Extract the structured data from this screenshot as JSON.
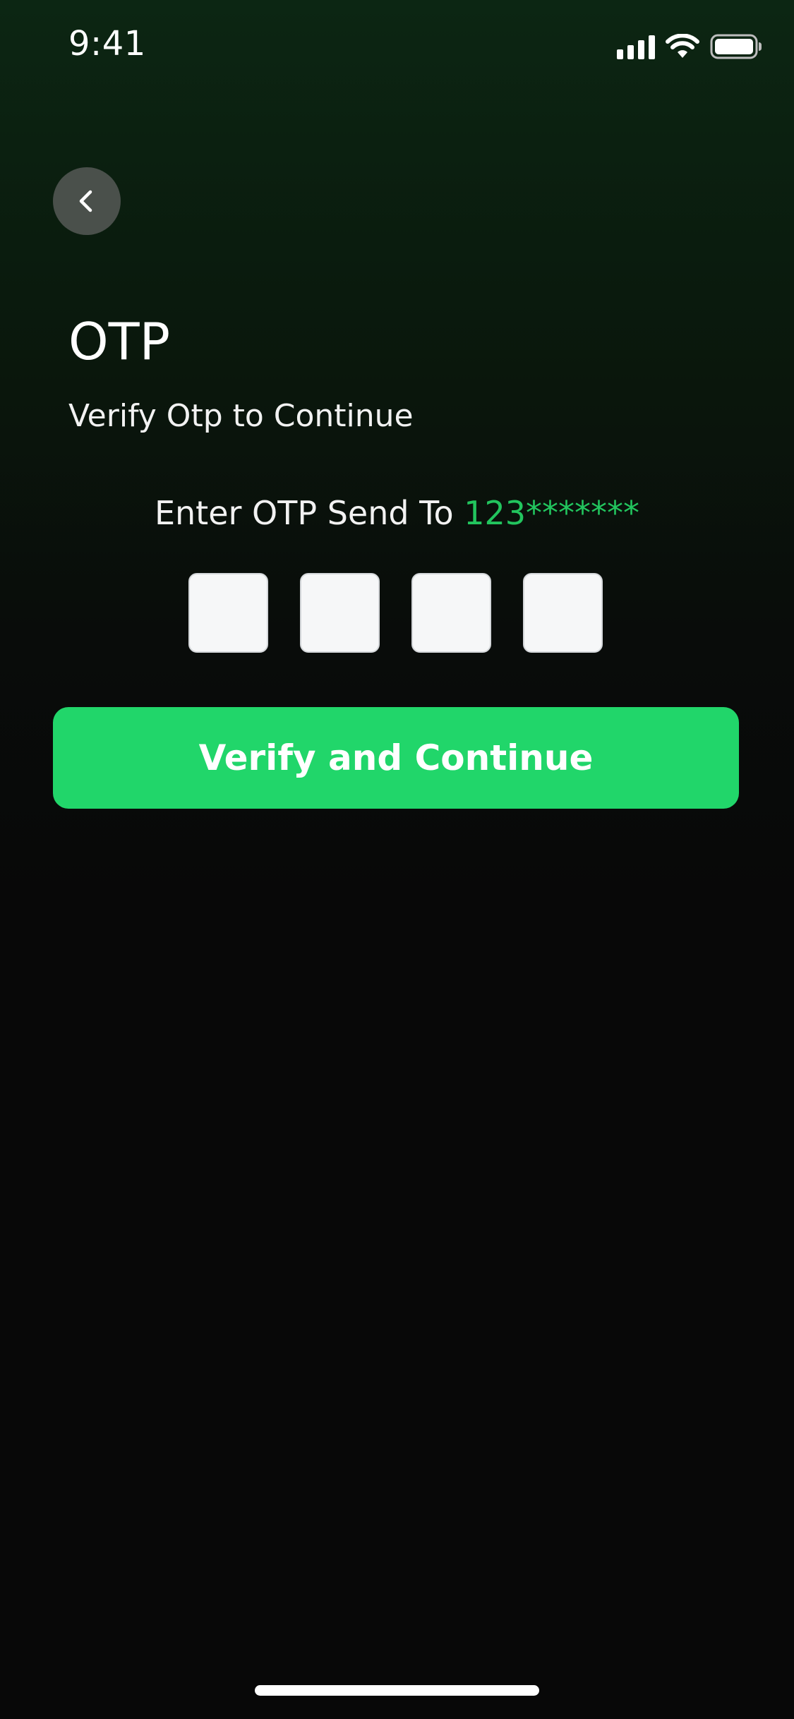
{
  "status_bar": {
    "time": "9:41",
    "icons": [
      "signal-icon",
      "wifi-icon",
      "battery-icon"
    ]
  },
  "header": {
    "back_icon": "chevron-left-icon"
  },
  "main": {
    "title": "OTP",
    "subtitle": "Verify Otp to Continue",
    "prompt_prefix": "Enter OTP Send To ",
    "masked_number": "123*******",
    "otp_digits": [
      "",
      "",
      "",
      ""
    ],
    "verify_label": "Verify and Continue"
  },
  "colors": {
    "accent": "#21d66a",
    "masked_number": "#22c55e",
    "back_button_bg": "#4a504b",
    "background_top": "#0c2613",
    "background_bottom": "#080808"
  }
}
